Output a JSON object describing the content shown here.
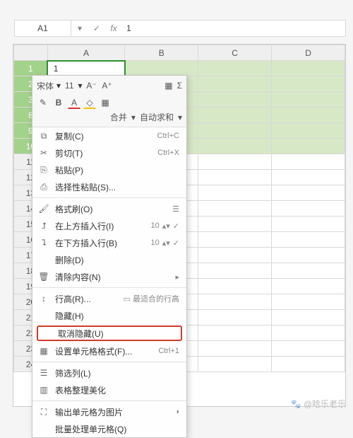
{
  "formula_bar": {
    "name_box": "A1",
    "dropdown_icon": "▾",
    "check_icon": "✓",
    "fx_label": "fx",
    "content": "1"
  },
  "columns": [
    "A",
    "B",
    "C",
    "D"
  ],
  "visible_rows": [
    "1",
    "2",
    "3",
    "8",
    "9",
    "10",
    "11",
    "12",
    "13",
    "14",
    "15",
    "16",
    "17",
    "18",
    "19",
    "20",
    "21",
    "22",
    "23",
    "24"
  ],
  "selected_rows": [
    "1",
    "2",
    "3",
    "8",
    "9",
    "10"
  ],
  "active_cell_value": "1",
  "mini_toolbar": {
    "font_name": "宋体",
    "font_size": "11",
    "dec_a": "A⁻",
    "inc_a": "A⁺",
    "merge_label": "合并",
    "sum_label": "自动求和",
    "sum_icon": "Σ",
    "cells_icon": "▦",
    "copy_format": "✎",
    "bold": "B",
    "font_color": "A",
    "fill_color": "◇",
    "borders": "▦"
  },
  "menu": [
    {
      "icon": "⧉",
      "label": "复制(C)",
      "shortcut": "Ctrl+C"
    },
    {
      "icon": "✂",
      "label": "剪切(T)",
      "shortcut": "Ctrl+X"
    },
    {
      "icon": "⎘",
      "label": "粘贴(P)",
      "shortcut": ""
    },
    {
      "icon": "⎙",
      "label": "选择性粘贴(S)...",
      "shortcut": ""
    },
    {
      "sep": true
    },
    {
      "icon": "🖌",
      "label": "格式刷(O)",
      "shortcut": "",
      "tail_icon": "☰"
    },
    {
      "icon": "⮥",
      "label": "在上方插入行(I)",
      "shortcut": "",
      "spinner": "10"
    },
    {
      "icon": "⮧",
      "label": "在下方插入行(B)",
      "shortcut": "",
      "spinner": "10"
    },
    {
      "icon": "",
      "label": "删除(D)",
      "shortcut": ""
    },
    {
      "icon": "🗑",
      "label": "清除内容(N)",
      "shortcut": "",
      "arrow": "▸"
    },
    {
      "sep": true
    },
    {
      "icon": "↕",
      "label": "行高(R)...",
      "shortcut": "",
      "tail_icon": "▭",
      "tail_text": "最适合的行高"
    },
    {
      "icon": "",
      "label": "隐藏(H)",
      "shortcut": ""
    },
    {
      "icon": "",
      "label": "取消隐藏(U)",
      "shortcut": "",
      "highlight": true
    },
    {
      "icon": "▦",
      "label": "设置单元格格式(F)...",
      "shortcut": "Ctrl+1"
    },
    {
      "sep": true
    },
    {
      "icon": "☰",
      "label": "筛选列(L)",
      "shortcut": ""
    },
    {
      "icon": "▥",
      "label": "表格整理美化",
      "shortcut": ""
    },
    {
      "sep": true
    },
    {
      "icon": "⛶",
      "label": "输出单元格为图片",
      "shortcut": "",
      "badge": "◑"
    },
    {
      "icon": "",
      "label": "批量处理单元格(Q)",
      "shortcut": ""
    }
  ],
  "watermark": {
    "paw": "🐾",
    "text": "@哈乐老乐"
  }
}
